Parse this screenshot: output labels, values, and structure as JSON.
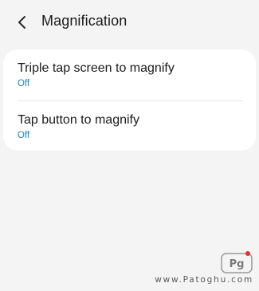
{
  "header": {
    "back_icon": "chevron-left-icon",
    "title": "Magnification"
  },
  "settings": {
    "items": [
      {
        "label": "Triple tap screen to magnify",
        "value": "Off"
      },
      {
        "label": "Tap button to magnify",
        "value": "Off"
      }
    ]
  },
  "watermark": {
    "logo_text": "Pg",
    "url": "www.Patoghu.com"
  },
  "colors": {
    "background": "#f4f4f4",
    "card": "#ffffff",
    "accent": "#1b80d6",
    "text": "#1a1a1a"
  }
}
